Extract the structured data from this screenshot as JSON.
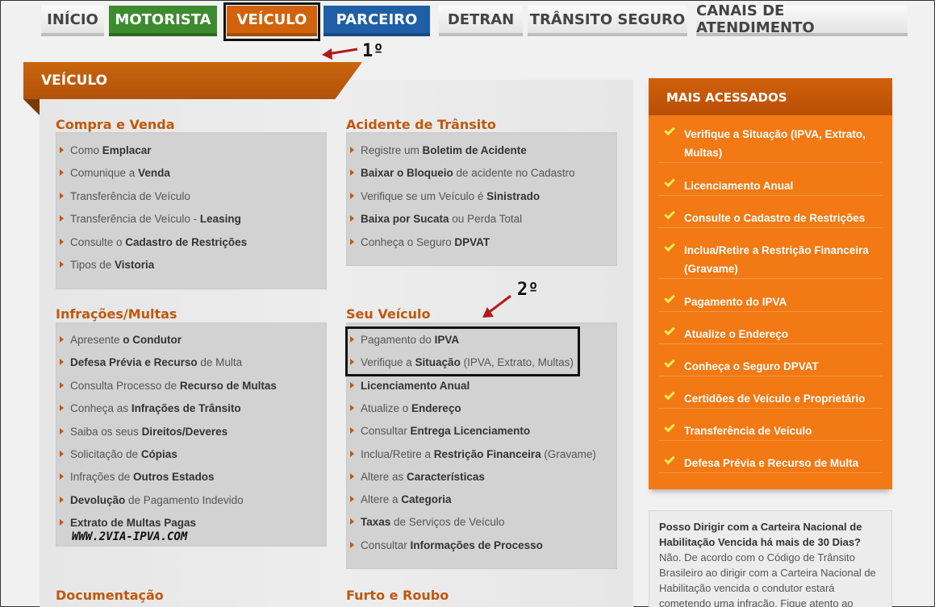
{
  "nav": {
    "tabs": [
      {
        "label": "INÍCIO"
      },
      {
        "label": "MOTORISTA"
      },
      {
        "label": "VEÍCULO"
      },
      {
        "label": "PARCEIRO"
      },
      {
        "label": "DETRAN"
      },
      {
        "label": "TRÂNSITO SEGURO"
      },
      {
        "label": "CANAIS DE ATENDIMENTO"
      }
    ]
  },
  "annotations": {
    "first": "1º",
    "second": "2º"
  },
  "watermark": "WWW.2VIA-IPVA.COM",
  "panel": {
    "title": "VEÍCULO",
    "sections": {
      "compra": {
        "title": "Compra e Venda",
        "items": [
          [
            {
              "t": "Como "
            },
            {
              "b": "Emplacar"
            }
          ],
          [
            {
              "t": "Comunique a "
            },
            {
              "b": "Venda"
            }
          ],
          [
            {
              "t": "Transferência de Veículo"
            }
          ],
          [
            {
              "t": "Transferência de Veículo - "
            },
            {
              "b": "Leasing"
            }
          ],
          [
            {
              "t": "Consulte o "
            },
            {
              "b": "Cadastro de Restrições"
            }
          ],
          [
            {
              "t": "Tipos de "
            },
            {
              "b": "Vistoria"
            }
          ]
        ]
      },
      "acidente": {
        "title": "Acidente de Trânsito",
        "items": [
          [
            {
              "t": "Registre um "
            },
            {
              "b": "Boletim de Acidente"
            }
          ],
          [
            {
              "b": "Baixar o Bloqueio"
            },
            {
              "t": " de acidente no Cadastro"
            }
          ],
          [
            {
              "t": "Verifique se um Veículo é "
            },
            {
              "b": "Sinistrado"
            }
          ],
          [
            {
              "b": "Baixa por Sucata"
            },
            {
              "t": " ou Perda Total"
            }
          ],
          [
            {
              "t": "Conheça o Seguro "
            },
            {
              "b": "DPVAT"
            }
          ]
        ]
      },
      "infracoes": {
        "title": "Infrações/Multas",
        "items": [
          [
            {
              "t": "Apresente "
            },
            {
              "b": "o Condutor"
            }
          ],
          [
            {
              "b": "Defesa Prévia e Recurso"
            },
            {
              "t": " de Multa"
            }
          ],
          [
            {
              "t": "Consulta Processo de "
            },
            {
              "b": "Recurso de Multas"
            }
          ],
          [
            {
              "t": "Conheça as "
            },
            {
              "b": "Infrações de Trânsito"
            }
          ],
          [
            {
              "t": "Saiba os seus "
            },
            {
              "b": "Direitos/Deveres"
            }
          ],
          [
            {
              "t": "Solicitação de "
            },
            {
              "b": "Cópias"
            }
          ],
          [
            {
              "t": "Infrações de "
            },
            {
              "b": "Outros Estados"
            }
          ],
          [
            {
              "b": "Devolução"
            },
            {
              "t": " de Pagamento Indevido"
            }
          ],
          [
            {
              "b": "Extrato de Multas Pagas"
            }
          ]
        ]
      },
      "seu_veiculo": {
        "title": "Seu Veículo",
        "items": [
          [
            {
              "t": "Pagamento do "
            },
            {
              "b": "IPVA"
            }
          ],
          [
            {
              "t": "Verifique a "
            },
            {
              "b": "Situação"
            },
            {
              "t": " (IPVA, Extrato, Multas)"
            }
          ],
          [
            {
              "b": "Licenciamento Anual"
            }
          ],
          [
            {
              "t": "Atualize o "
            },
            {
              "b": "Endereço"
            }
          ],
          [
            {
              "t": "Consultar "
            },
            {
              "b": "Entrega Licenciamento"
            }
          ],
          [
            {
              "t": "Inclua/Retire a "
            },
            {
              "b": "Restrição Financeira"
            },
            {
              "t": " (Gravame)"
            }
          ],
          [
            {
              "t": "Altere as "
            },
            {
              "b": "Características"
            }
          ],
          [
            {
              "t": "Altere a "
            },
            {
              "b": "Categoria"
            }
          ],
          [
            {
              "b": "Taxas"
            },
            {
              "t": " de Serviços de Veículo"
            }
          ],
          [
            {
              "t": "Consultar "
            },
            {
              "b": "Informações de Processo"
            }
          ]
        ]
      },
      "documentacao": {
        "title": "Documentação"
      },
      "furto": {
        "title": "Furto e Roubo"
      }
    }
  },
  "sidebar": {
    "title": "MAIS ACESSADOS",
    "items": [
      {
        "label": "Verifique a Situação (IPVA, Extrato, Multas)"
      },
      {
        "label": "Licenciamento Anual"
      },
      {
        "label": "Consulte o Cadastro de Restrições"
      },
      {
        "label": "Inclua/Retire a Restrição Financeira (Gravame)"
      },
      {
        "label": "Pagamento do IPVA"
      },
      {
        "label": "Atualize o Endereço"
      },
      {
        "label": "Conheça o Seguro DPVAT"
      },
      {
        "label": "Certidões de Veículo e Proprietário"
      },
      {
        "label": "Transferência de Veículo"
      },
      {
        "label": "Defesa Prévia e Recurso de Multa"
      }
    ]
  },
  "faq": {
    "question": "Posso Dirigir com a Carteira Nacional de Habilitação Vencida há mais de 30 Dias?",
    "answer": "Não. De acordo com o Código de Trânsito Brasileiro ao dirigir com a Carteira Nacional de Habilitação vencida o condutor estará cometendo uma infração. Fique atento ao"
  }
}
